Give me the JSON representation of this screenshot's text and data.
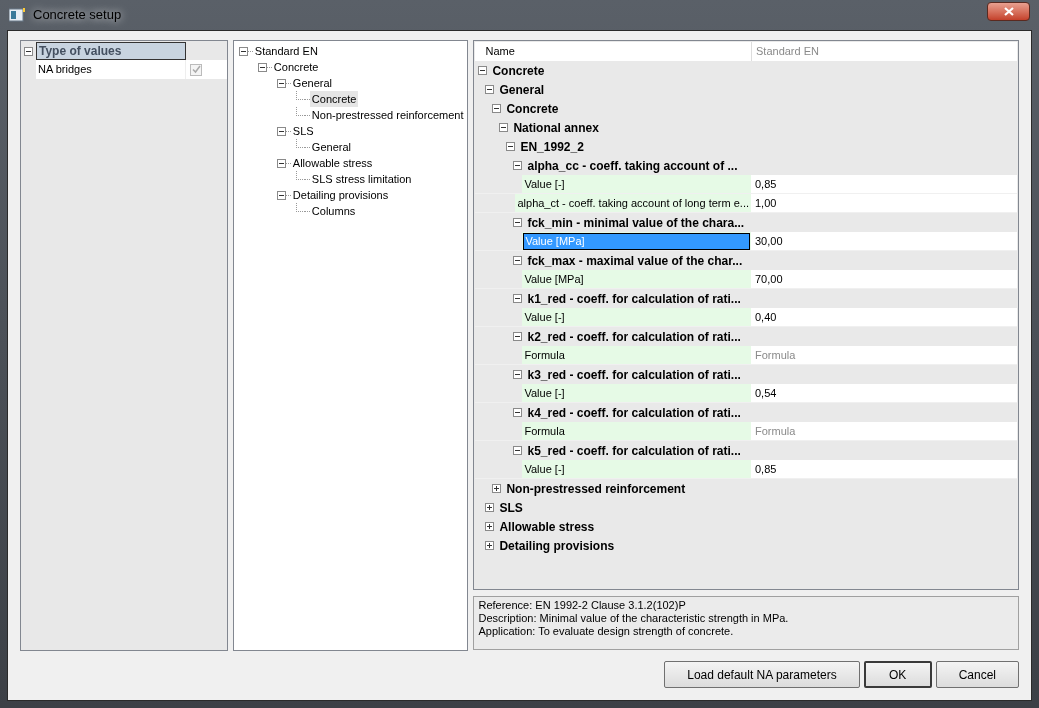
{
  "window": {
    "title": "Concrete setup"
  },
  "settings_panel": {
    "group": {
      "label": "Type of values",
      "expanded": true,
      "selected": true
    },
    "items": [
      {
        "label": "NA bridges",
        "checked": true,
        "disabled": true
      }
    ]
  },
  "tree": [
    {
      "label": "Standard EN",
      "expanded": true,
      "selected": false,
      "children": [
        {
          "label": "Concrete",
          "expanded": true,
          "selected": false,
          "children": [
            {
              "label": "General",
              "expanded": true,
              "selected": false,
              "children": [
                {
                  "label": "Concrete",
                  "selected": true
                },
                {
                  "label": "Non-prestressed reinforcement",
                  "selected": false
                }
              ]
            },
            {
              "label": "SLS",
              "expanded": true,
              "selected": false,
              "children": [
                {
                  "label": "General",
                  "selected": false
                }
              ]
            },
            {
              "label": "Allowable stress",
              "expanded": true,
              "selected": false,
              "children": [
                {
                  "label": "SLS stress limitation",
                  "selected": false
                }
              ]
            },
            {
              "label": "Detailing provisions",
              "expanded": true,
              "selected": false,
              "children": [
                {
                  "label": "Columns",
                  "selected": false
                }
              ]
            }
          ]
        }
      ]
    }
  ],
  "grid": {
    "columns": [
      "Name",
      "Standard EN"
    ],
    "rows": [
      {
        "kind": "group",
        "label": "Concrete",
        "expanded": true,
        "children": [
          {
            "kind": "group",
            "label": "General",
            "expanded": true,
            "children": [
              {
                "kind": "group",
                "label": "Concrete",
                "expanded": true,
                "children": [
                  {
                    "kind": "group",
                    "label": "National annex",
                    "expanded": true,
                    "children": [
                      {
                        "kind": "group",
                        "label": "EN_1992_2",
                        "expanded": true,
                        "children": [
                          {
                            "kind": "group",
                            "label": "alpha_cc -  coeff. taking account of ...",
                            "expanded": true,
                            "children": [
                              {
                                "kind": "property",
                                "name": "Value [-]",
                                "value": "0,85",
                                "selected": false,
                                "disabled": false
                              }
                            ]
                          },
                          {
                            "kind": "property",
                            "name": "alpha_ct - coeff. taking account of long term e...",
                            "value": "1,00",
                            "selected": false,
                            "disabled": false
                          },
                          {
                            "kind": "group",
                            "label": "fck_min - minimal value of the chara...",
                            "expanded": true,
                            "children": [
                              {
                                "kind": "property",
                                "name": "Value [MPa]",
                                "value": "30,00",
                                "selected": true,
                                "disabled": false
                              }
                            ]
                          },
                          {
                            "kind": "group",
                            "label": "fck_max - maximal value of the char...",
                            "expanded": true,
                            "children": [
                              {
                                "kind": "property",
                                "name": "Value [MPa]",
                                "value": "70,00",
                                "selected": false,
                                "disabled": false
                              }
                            ]
                          },
                          {
                            "kind": "group",
                            "label": "k1_red - coeff. for calculation of rati...",
                            "expanded": true,
                            "children": [
                              {
                                "kind": "property",
                                "name": "Value [-]",
                                "value": "0,40",
                                "selected": false,
                                "disabled": false
                              }
                            ]
                          },
                          {
                            "kind": "group",
                            "label": "k2_red - coeff. for calculation of rati...",
                            "expanded": true,
                            "children": [
                              {
                                "kind": "property",
                                "name": "Formula",
                                "value": "Formula",
                                "selected": false,
                                "disabled": true
                              }
                            ]
                          },
                          {
                            "kind": "group",
                            "label": "k3_red - coeff. for calculation of rati...",
                            "expanded": true,
                            "children": [
                              {
                                "kind": "property",
                                "name": "Value [-]",
                                "value": "0,54",
                                "selected": false,
                                "disabled": false
                              }
                            ]
                          },
                          {
                            "kind": "group",
                            "label": "k4_red - coeff. for calculation of rati...",
                            "expanded": true,
                            "children": [
                              {
                                "kind": "property",
                                "name": "Formula",
                                "value": "Formula",
                                "selected": false,
                                "disabled": true
                              }
                            ]
                          },
                          {
                            "kind": "group",
                            "label": "k5_red - coeff. for calculation of rati...",
                            "expanded": true,
                            "children": [
                              {
                                "kind": "property",
                                "name": "Value [-]",
                                "value": "0,85",
                                "selected": false,
                                "disabled": false
                              }
                            ]
                          }
                        ]
                      }
                    ]
                  }
                ]
              },
              {
                "kind": "group",
                "label": "Non-prestressed reinforcement",
                "expanded": false
              }
            ]
          },
          {
            "kind": "group",
            "label": "SLS",
            "expanded": false
          },
          {
            "kind": "group",
            "label": "Allowable stress",
            "expanded": false
          },
          {
            "kind": "group",
            "label": "Detailing provisions",
            "expanded": false
          }
        ]
      }
    ]
  },
  "info": [
    "Reference: EN 1992-2 Clause 3.1.2(102)P",
    "Description: Minimal value of the characteristic strength in MPa.",
    "Application: To evaluate design strength of concrete."
  ],
  "buttons": [
    {
      "label": "Load default NA parameters",
      "default": false
    },
    {
      "label": "OK",
      "default": true
    },
    {
      "label": "Cancel",
      "default": false
    }
  ]
}
